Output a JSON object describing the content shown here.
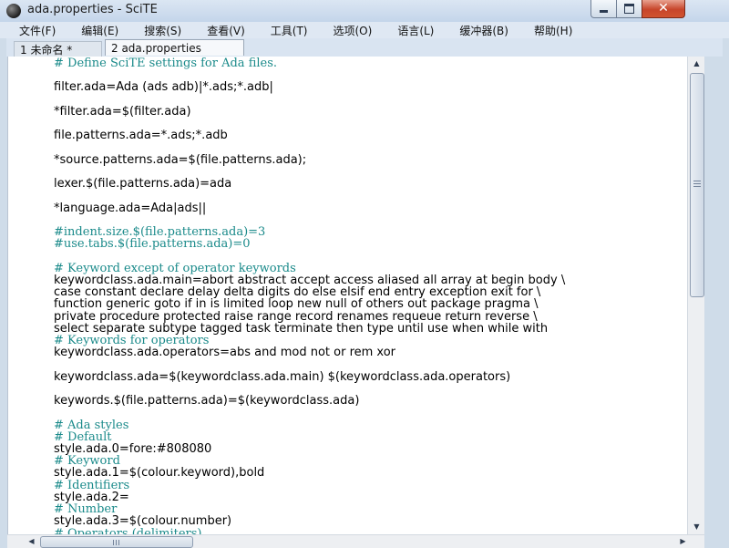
{
  "window": {
    "title": "ada.properties - SciTE",
    "icon": "scite-app-icon",
    "close_glyph": "✕"
  },
  "menu": [
    {
      "label": "文件(F)"
    },
    {
      "label": "编辑(E)"
    },
    {
      "label": "搜索(S)"
    },
    {
      "label": "查看(V)"
    },
    {
      "label": "工具(T)"
    },
    {
      "label": "选项(O)"
    },
    {
      "label": "语言(L)"
    },
    {
      "label": "缓冲器(B)"
    },
    {
      "label": "帮助(H)"
    }
  ],
  "tabs": [
    {
      "label": "1 未命名 *",
      "active": false
    },
    {
      "label": "2 ada.properties",
      "active": true
    }
  ],
  "editor": {
    "comment_color": "#1a8a8a",
    "lines": [
      {
        "text": "# Define SciTE settings for Ada files.",
        "type": "comment"
      },
      {
        "text": "",
        "type": "code"
      },
      {
        "text": "filter.ada=Ada (ads adb)|*.ads;*.adb|",
        "type": "code"
      },
      {
        "text": "",
        "type": "code"
      },
      {
        "text": "*filter.ada=$(filter.ada)",
        "type": "code"
      },
      {
        "text": "",
        "type": "code"
      },
      {
        "text": "file.patterns.ada=*.ads;*.adb",
        "type": "code"
      },
      {
        "text": "",
        "type": "code"
      },
      {
        "text": "*source.patterns.ada=$(file.patterns.ada);",
        "type": "code"
      },
      {
        "text": "",
        "type": "code"
      },
      {
        "text": "lexer.$(file.patterns.ada)=ada",
        "type": "code"
      },
      {
        "text": "",
        "type": "code"
      },
      {
        "text": "*language.ada=Ada|ads||",
        "type": "code"
      },
      {
        "text": "",
        "type": "code"
      },
      {
        "text": "#indent.size.$(file.patterns.ada)=3",
        "type": "comment"
      },
      {
        "text": "#use.tabs.$(file.patterns.ada)=0",
        "type": "comment"
      },
      {
        "text": "",
        "type": "code"
      },
      {
        "text": "# Keyword except of operator keywords",
        "type": "comment"
      },
      {
        "text": "keywordclass.ada.main=abort abstract accept access aliased all array at begin body \\",
        "type": "code"
      },
      {
        "text": "case constant declare delay delta digits do else elsif end entry exception exit for \\",
        "type": "code"
      },
      {
        "text": "function generic goto if in is limited loop new null of others out package pragma \\",
        "type": "code"
      },
      {
        "text": "private procedure protected raise range record renames requeue return reverse \\",
        "type": "code"
      },
      {
        "text": "select separate subtype tagged task terminate then type until use when while with",
        "type": "code"
      },
      {
        "text": "# Keywords for operators",
        "type": "comment"
      },
      {
        "text": "keywordclass.ada.operators=abs and mod not or rem xor",
        "type": "code"
      },
      {
        "text": "",
        "type": "code"
      },
      {
        "text": "keywordclass.ada=$(keywordclass.ada.main) $(keywordclass.ada.operators)",
        "type": "code"
      },
      {
        "text": "",
        "type": "code"
      },
      {
        "text": "keywords.$(file.patterns.ada)=$(keywordclass.ada)",
        "type": "code"
      },
      {
        "text": "",
        "type": "code"
      },
      {
        "text": "# Ada styles",
        "type": "comment"
      },
      {
        "text": "# Default",
        "type": "comment"
      },
      {
        "text": "style.ada.0=fore:#808080",
        "type": "code"
      },
      {
        "text": "# Keyword",
        "type": "comment"
      },
      {
        "text": "style.ada.1=$(colour.keyword),bold",
        "type": "code"
      },
      {
        "text": "# Identifiers",
        "type": "comment"
      },
      {
        "text": "style.ada.2=",
        "type": "code"
      },
      {
        "text": "# Number",
        "type": "comment"
      },
      {
        "text": "style.ada.3=$(colour.number)",
        "type": "code"
      },
      {
        "text": "# Operators (delimiters)",
        "type": "comment"
      }
    ]
  },
  "scrollbars": {
    "vertical_up": "▲",
    "vertical_down": "▼",
    "horizontal_left": "◀",
    "horizontal_right": "▶"
  }
}
